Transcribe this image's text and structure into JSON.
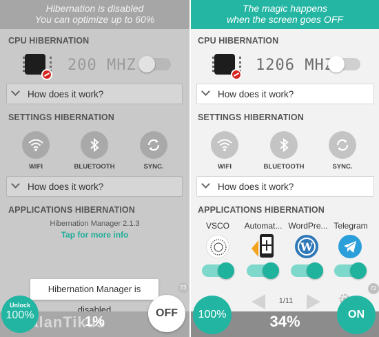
{
  "left": {
    "banner_line1": "Hibernation is disabled",
    "banner_line2": "You can optimize up to 60%",
    "cpu_title": "CPU HIBERNATION",
    "cpu_freq": "200 MHZ",
    "how_text_1": "How does it work?",
    "settings_title": "SETTINGS HIBERNATION",
    "settings": [
      "WIFI",
      "BLUETOOTH",
      "SYNC."
    ],
    "how_text_2": "How does it work?",
    "apps_title": "APPLICATIONS HIBERNATION",
    "version": "Hibernation Manager 2.1.3",
    "more_info": "Tap for more info",
    "toast": "Hibernation Manager is disabled",
    "unlock_label": "Unlock",
    "unlock_pct": "100%",
    "percent": "1%",
    "off_label": "OFF",
    "badge": "73",
    "watermark": "JalanTikus"
  },
  "right": {
    "banner_line1": "The magic happens",
    "banner_line2": "when the screen goes OFF",
    "cpu_title": "CPU HIBERNATION",
    "cpu_freq": "1206 MHZ",
    "how_text_1": "How does it work?",
    "settings_title": "SETTINGS HIBERNATION",
    "settings": [
      "WIFI",
      "BLUETOOTH",
      "SYNC."
    ],
    "how_text_2": "How does it work?",
    "apps_title": "APPLICATIONS HIBERNATION",
    "apps": [
      {
        "label": "VSCO",
        "icon": "vsco-icon",
        "enabled": true
      },
      {
        "label": "Automat...",
        "icon": "automation-icon",
        "enabled": true
      },
      {
        "label": "WordPre...",
        "icon": "wordpress-icon",
        "enabled": true
      },
      {
        "label": "Telegram",
        "icon": "telegram-icon",
        "enabled": true
      }
    ],
    "page_indicator": "1/11",
    "full_pct": "100%",
    "percent": "34%",
    "on_label": "ON",
    "badge": "72"
  },
  "colors": {
    "accent": "#22b5a2",
    "disabled_gray": "#c9c9c9"
  }
}
